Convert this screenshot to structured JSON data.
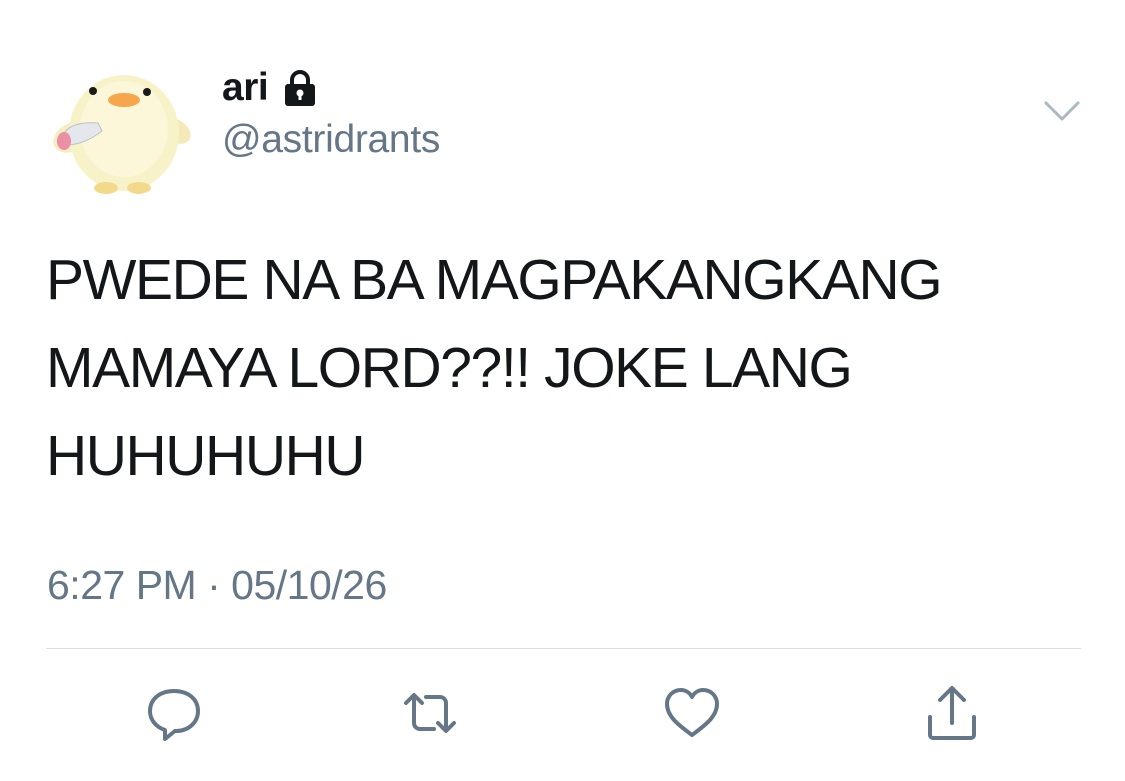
{
  "user": {
    "display_name": "ari",
    "handle": "@astridrants",
    "protected_icon": "lock-icon",
    "avatar": "chick-holding-knife-avatar"
  },
  "tweet": {
    "text": "PWEDE NA BA MAGPAKANGKANG\nMAMAYA LORD??!! JOKE LANG\nHUHUHUHU",
    "time": "6:27 PM",
    "separator": "·",
    "date": "05/10/26"
  },
  "actions": {
    "reply_icon": "reply-icon",
    "retweet_icon": "retweet-icon",
    "like_icon": "heart-icon",
    "share_icon": "share-icon",
    "more_icon": "chevron-down-icon"
  },
  "colors": {
    "text": "#14171a",
    "secondary": "#657786",
    "divider": "#d9e1e6"
  }
}
